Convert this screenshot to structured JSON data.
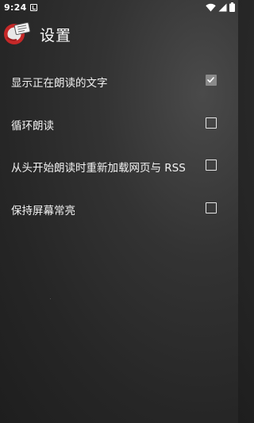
{
  "status_bar": {
    "time": "9:24",
    "icons": [
      "notification-icon",
      "wifi-icon",
      "signal-icon",
      "battery-icon"
    ]
  },
  "header": {
    "title": "设置",
    "app_icon": "app-logo-icon"
  },
  "settings": {
    "items": [
      {
        "label": "显示正在朗读的文字",
        "checked": true
      },
      {
        "label": "循环朗读",
        "checked": false
      },
      {
        "label": "从头开始朗读时重新加载网页与 RSS",
        "checked": false
      },
      {
        "label": "保持屏幕常亮",
        "checked": false
      }
    ]
  },
  "colors": {
    "background": "#2b2b2b",
    "text": "#ffffff",
    "checkbox_checked": "#8a8a8a",
    "logo_red": "#c62828"
  }
}
